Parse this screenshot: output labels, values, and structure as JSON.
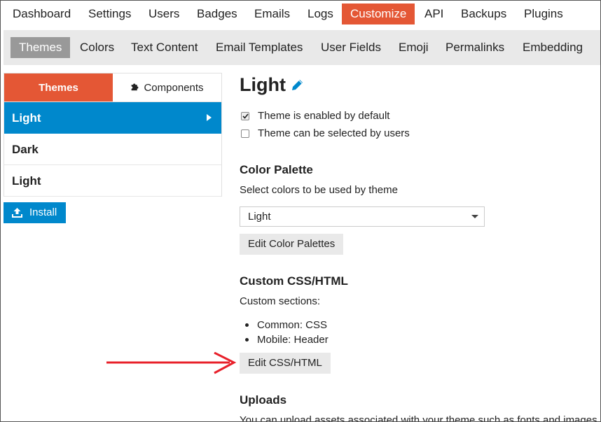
{
  "topnav": {
    "items": [
      "Dashboard",
      "Settings",
      "Users",
      "Badges",
      "Emails",
      "Logs",
      "Customize",
      "API",
      "Backups",
      "Plugins"
    ],
    "active": "Customize"
  },
  "subnav": {
    "items": [
      "Themes",
      "Colors",
      "Text Content",
      "Email Templates",
      "User Fields",
      "Emoji",
      "Permalinks",
      "Embedding"
    ],
    "active": "Themes"
  },
  "sidebar": {
    "tabs": {
      "themes": "Themes",
      "components": "Components"
    },
    "themes": [
      "Light",
      "Dark",
      "Light"
    ],
    "install_label": "Install"
  },
  "theme": {
    "title": "Light",
    "enabled_default_label": "Theme is enabled by default",
    "enabled_default_checked": true,
    "user_selectable_label": "Theme can be selected by users",
    "user_selectable_checked": false,
    "color_palette": {
      "heading": "Color Palette",
      "description": "Select colors to be used by theme",
      "selected": "Light",
      "edit_button": "Edit Color Palettes"
    },
    "custom_css": {
      "heading": "Custom CSS/HTML",
      "description": "Custom sections:",
      "sections": [
        "Common: CSS",
        "Mobile: Header"
      ],
      "edit_button": "Edit CSS/HTML"
    },
    "uploads": {
      "heading": "Uploads",
      "description": "You can upload assets associated with your theme such as fonts and images"
    }
  },
  "colors": {
    "accent": "#e45735",
    "selection": "#0088cc",
    "annotation_arrow": "#e8202a"
  },
  "icons": {
    "pencil": "pencil-icon",
    "caret": "caret-right-icon",
    "puzzle": "puzzle-piece-icon",
    "upload": "upload-icon",
    "check": "check-icon"
  }
}
